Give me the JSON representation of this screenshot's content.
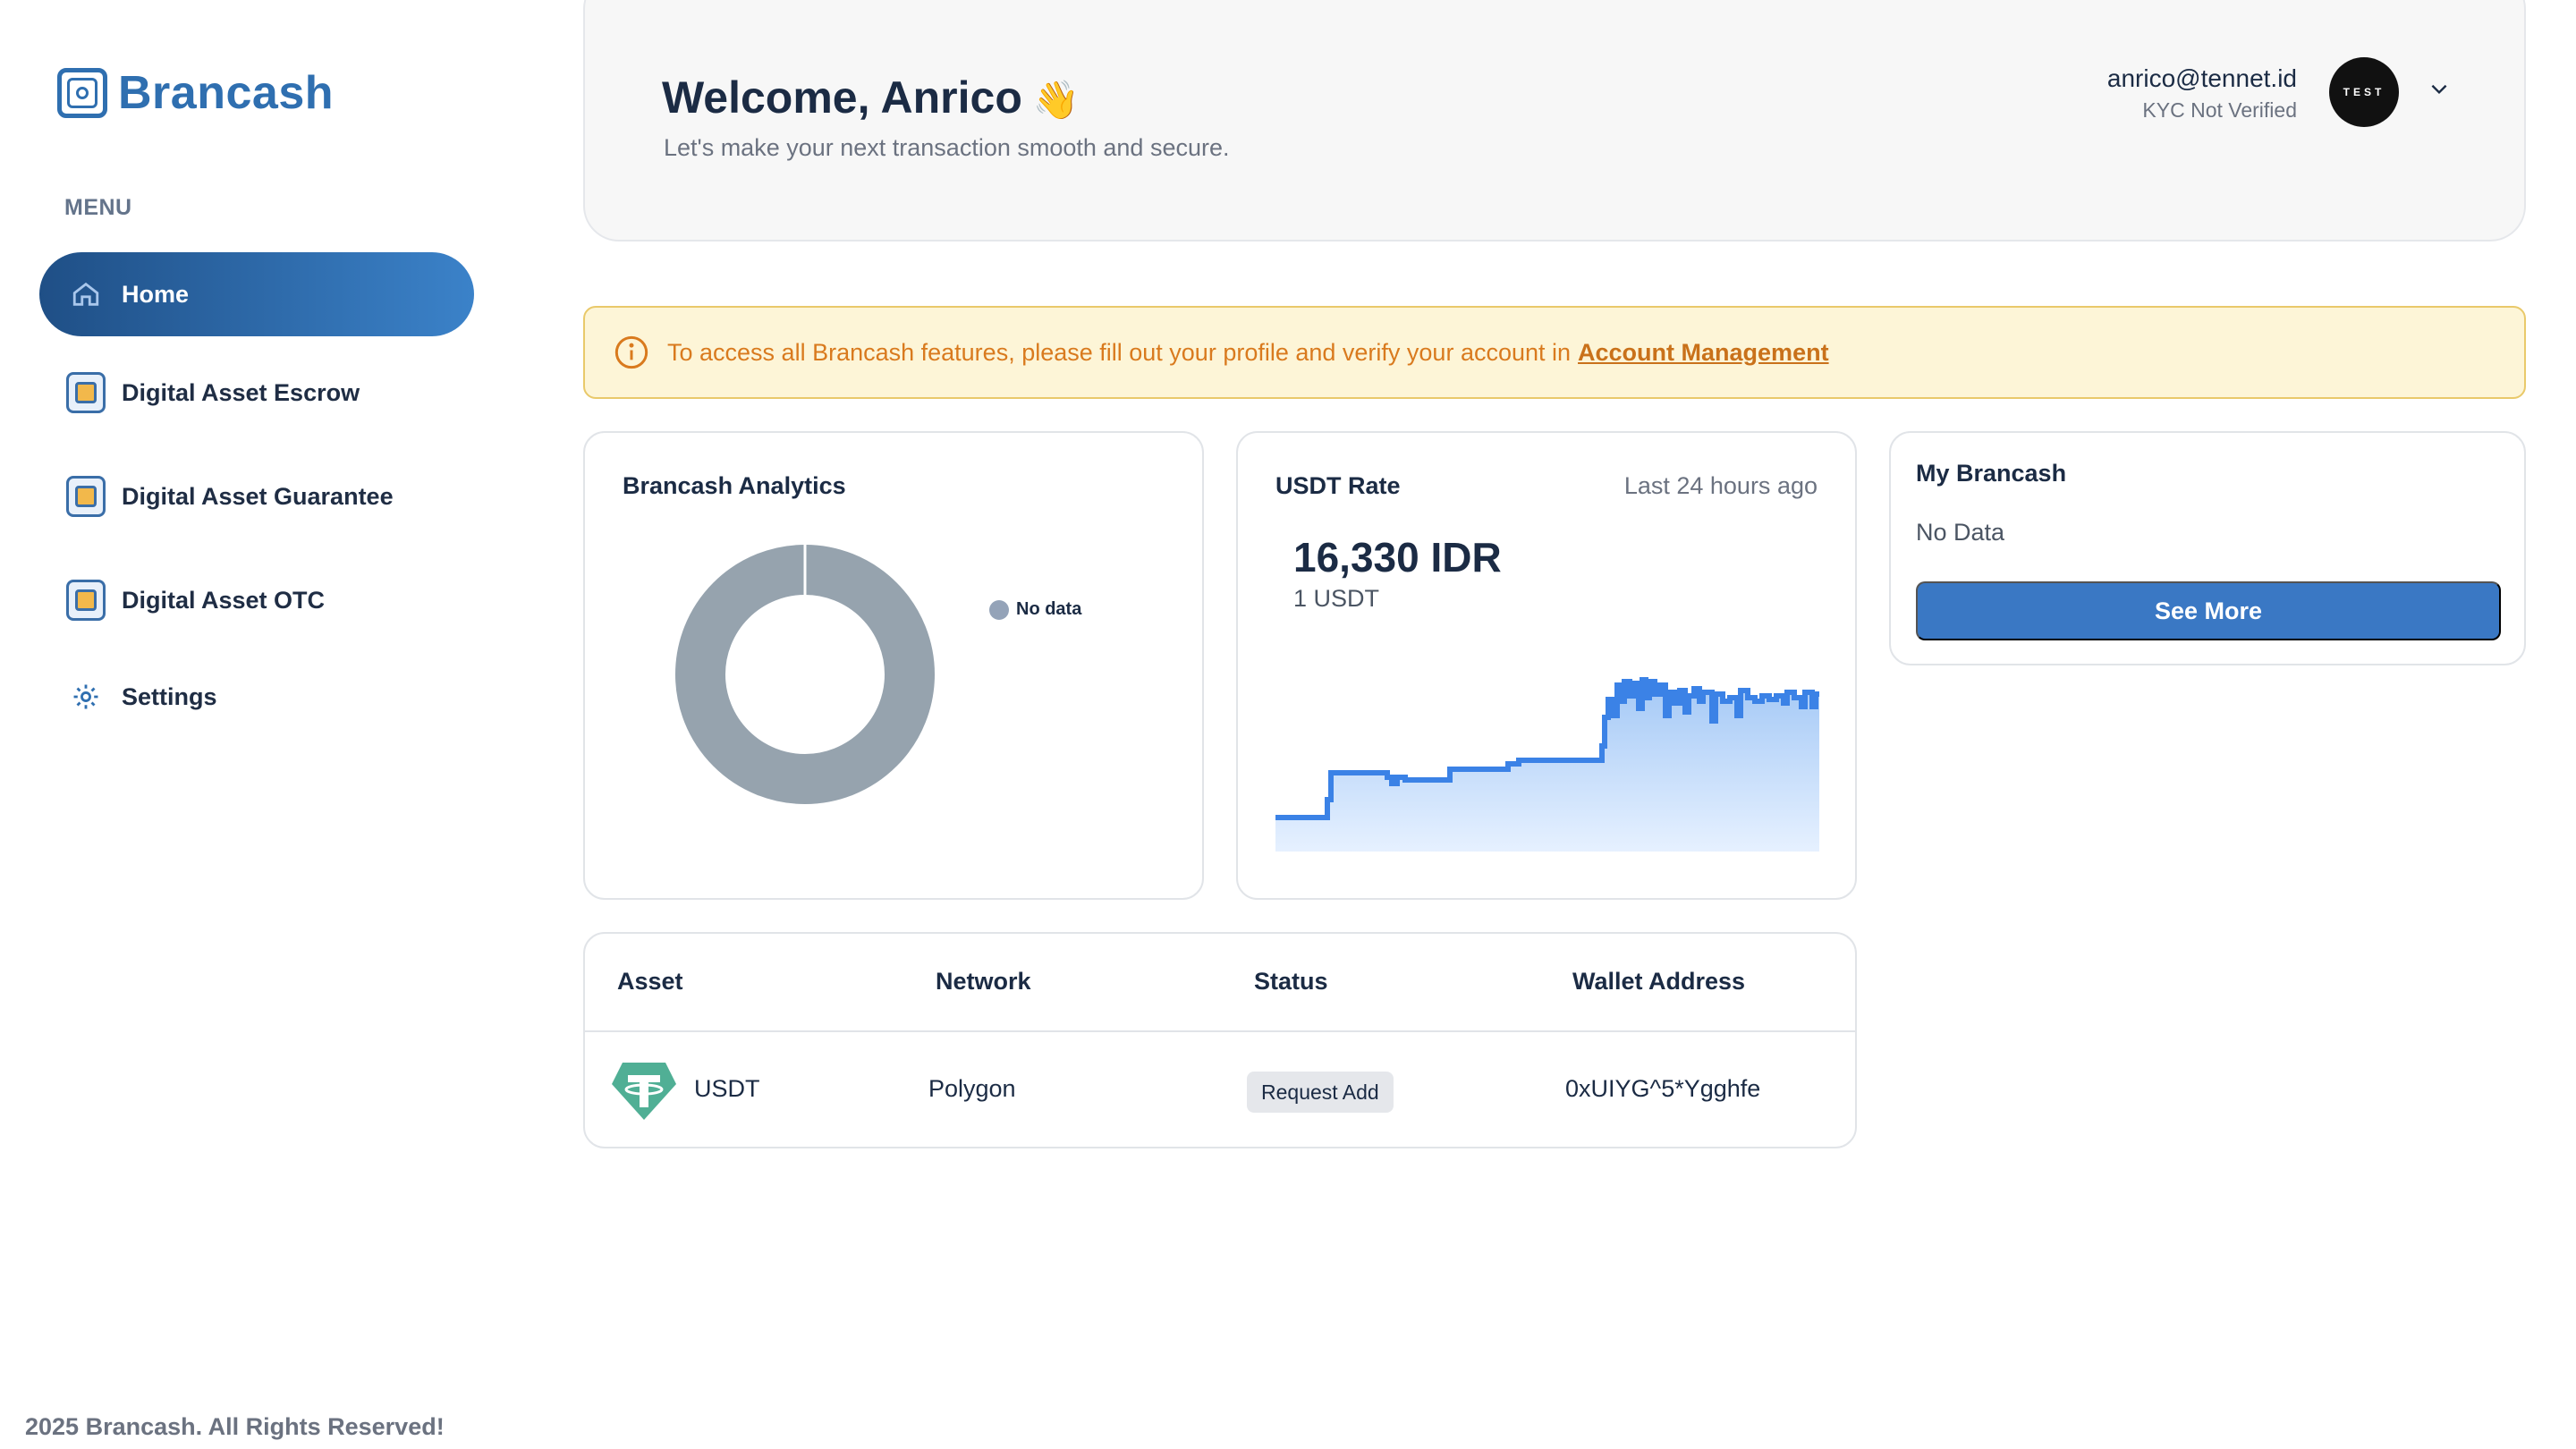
{
  "brand": {
    "name": "Brancash"
  },
  "sidebar": {
    "menu_label": "MENU",
    "items": [
      {
        "label": "Home",
        "icon": "home-icon",
        "active": true
      },
      {
        "label": "Digital Asset Escrow",
        "icon": "escrow-icon"
      },
      {
        "label": "Digital Asset Guarantee",
        "icon": "guarantee-icon"
      },
      {
        "label": "Digital Asset OTC",
        "icon": "otc-icon"
      },
      {
        "label": "Settings",
        "icon": "gear-icon"
      }
    ]
  },
  "header": {
    "welcome": "Welcome, Anrico",
    "wave_emoji": "👋",
    "subtitle": "Let's make your next transaction smooth and secure.",
    "user_email": "anrico@tennet.id",
    "kyc_status": "KYC Not Verified",
    "avatar_text": "TEST"
  },
  "alert": {
    "text": "To access all Brancash features, please fill out your profile and verify your account in",
    "link": "Account Management"
  },
  "analytics": {
    "title": "Brancash Analytics",
    "legend": "No data"
  },
  "rate": {
    "title": "USDT Rate",
    "period": "Last 24 hours ago",
    "value": "16,330 IDR",
    "unit": "1 USDT"
  },
  "my_brancash": {
    "title": "My Brancash",
    "empty": "No Data",
    "button": "See More"
  },
  "table": {
    "headers": [
      "Asset",
      "Network",
      "Status",
      "Wallet Address"
    ],
    "rows": [
      {
        "asset": "USDT",
        "network": "Polygon",
        "status": "Request Add",
        "wallet": "0xUIYG^5*Ygghfe"
      }
    ]
  },
  "footer": {
    "text": "2025 Brancash. All Rights Reserved!"
  },
  "colors": {
    "primary": "#2f6fb0",
    "alert_bg": "#fdf5d7",
    "alert_text": "#d97a1e",
    "chart_line": "#3b82e6"
  }
}
